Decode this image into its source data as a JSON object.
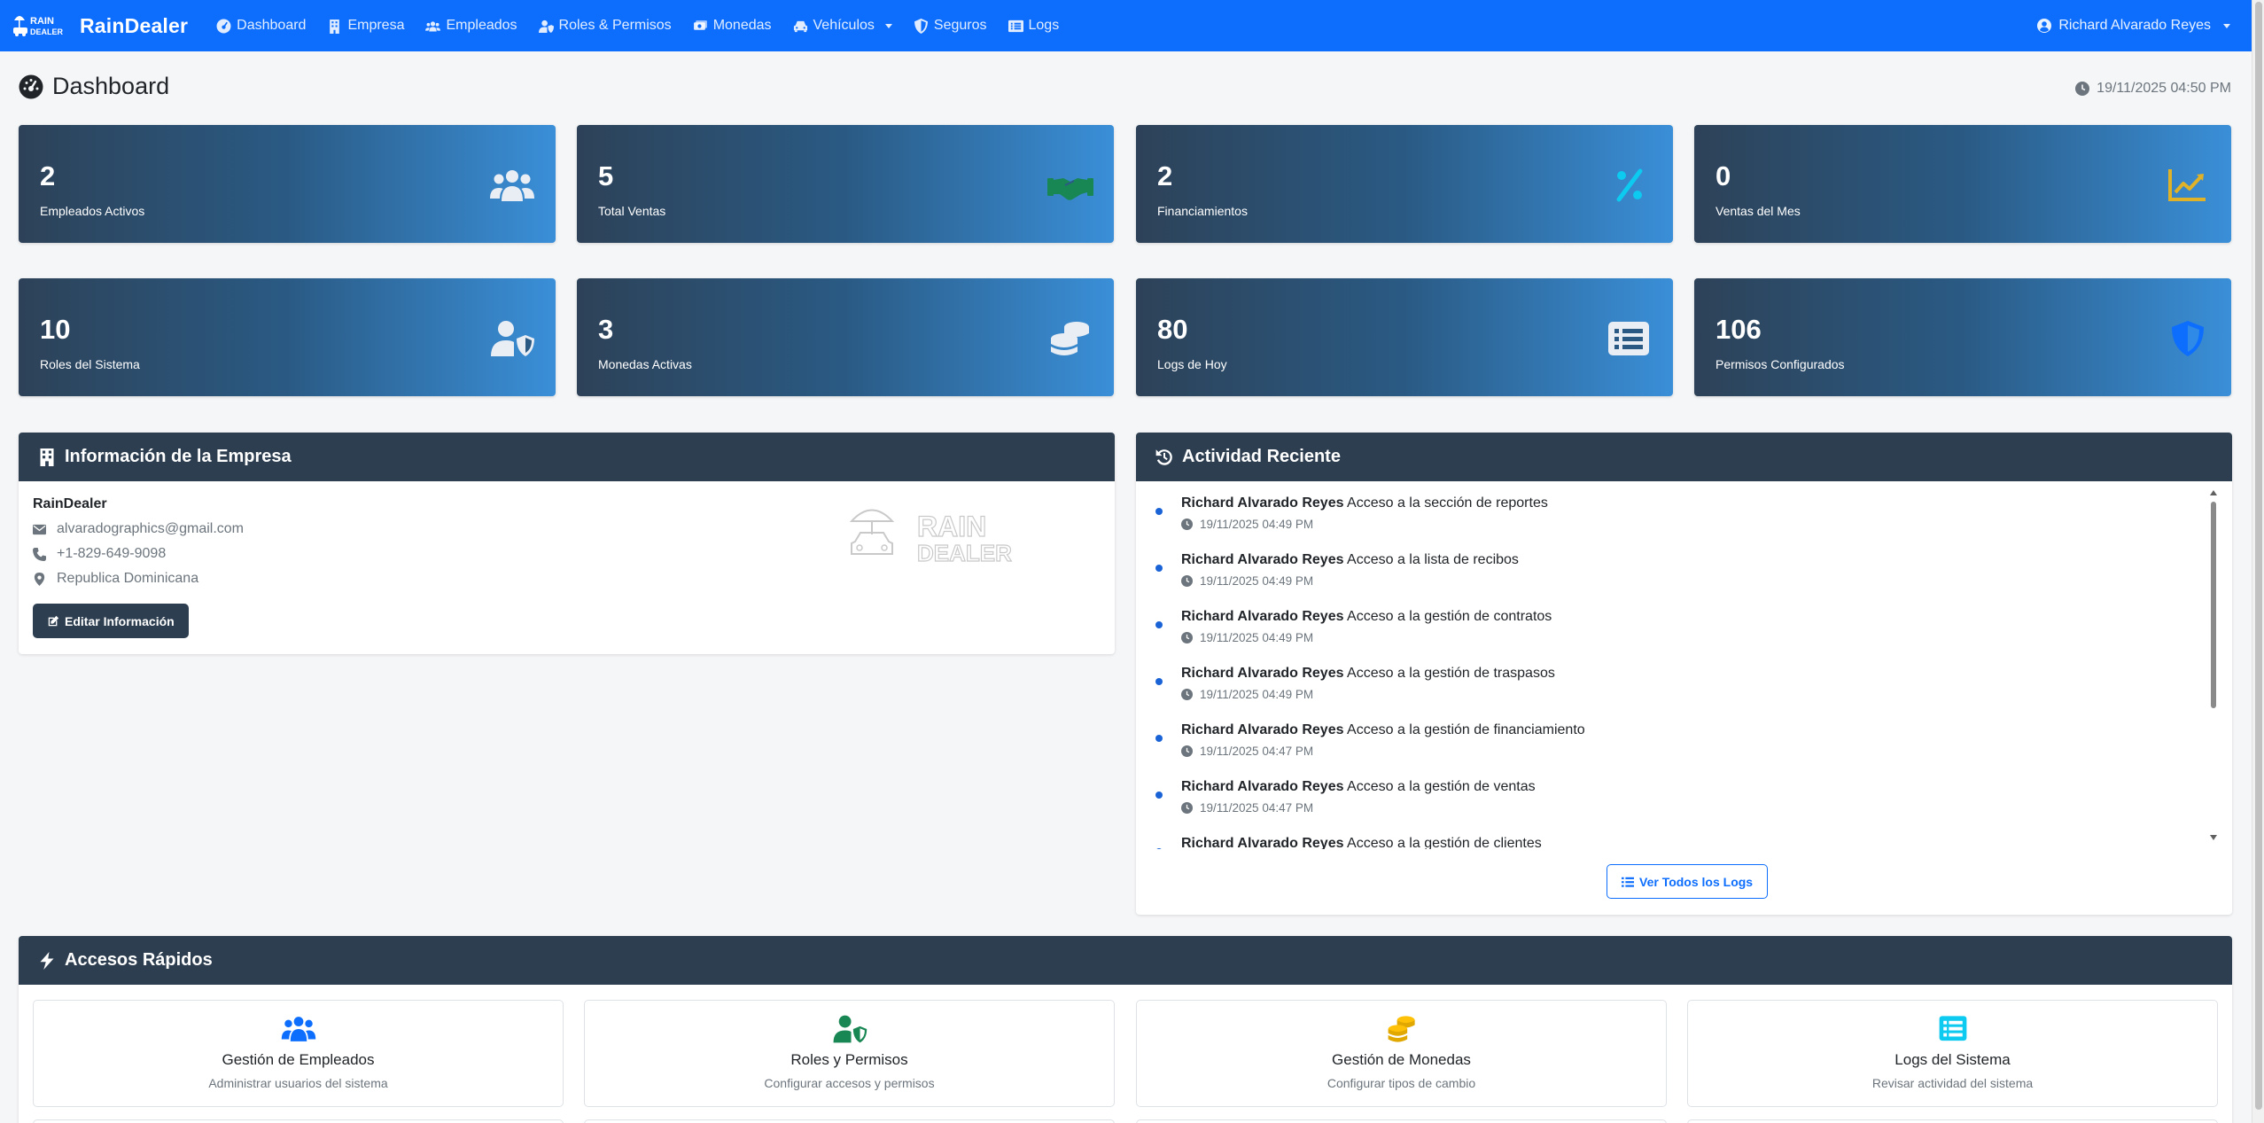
{
  "navbar": {
    "brand_logo_text": "RAIN DEALER",
    "brand": "RainDealer",
    "items": [
      {
        "label": "Dashboard",
        "icon": "dashboard-icon"
      },
      {
        "label": "Empresa",
        "icon": "building-icon"
      },
      {
        "label": "Empleados",
        "icon": "users-icon"
      },
      {
        "label": "Roles & Permisos",
        "icon": "user-shield-icon"
      },
      {
        "label": "Monedas",
        "icon": "money-icon"
      },
      {
        "label": "Vehículos",
        "icon": "car-icon",
        "dropdown": true
      },
      {
        "label": "Seguros",
        "icon": "shield-icon"
      },
      {
        "label": "Logs",
        "icon": "list-icon"
      }
    ],
    "user": "Richard Alvarado Reyes"
  },
  "header": {
    "title": "Dashboard",
    "timestamp": "19/11/2025 04:50 PM"
  },
  "stats": [
    {
      "value": "2",
      "label": "Empleados Activos",
      "icon": "users-icon",
      "color": "#e9eef5"
    },
    {
      "value": "5",
      "label": "Total Ventas",
      "icon": "handshake-icon",
      "color": "#198754"
    },
    {
      "value": "2",
      "label": "Financiamientos",
      "icon": "percent-icon",
      "color": "#0dcaf0"
    },
    {
      "value": "0",
      "label": "Ventas del Mes",
      "icon": "chart-line-icon",
      "color": "#e0b228"
    },
    {
      "value": "10",
      "label": "Roles del Sistema",
      "icon": "user-shield-icon",
      "color": "#e9eef5"
    },
    {
      "value": "3",
      "label": "Monedas Activas",
      "icon": "coins-icon",
      "color": "#e9eef5"
    },
    {
      "value": "80",
      "label": "Logs de Hoy",
      "icon": "list-alt-icon",
      "color": "#e9eef5"
    },
    {
      "value": "106",
      "label": "Permisos Configurados",
      "icon": "shield-icon",
      "color": "#0d6efd"
    }
  ],
  "company": {
    "title": "Información de la Empresa",
    "name": "RainDealer",
    "email": "alvaradographics@gmail.com",
    "phone": "+1-829-649-9098",
    "location": "Republica Dominicana",
    "edit_button": "Editar Información",
    "watermark_text": "RAIN DEALER"
  },
  "activity": {
    "title": "Actividad Reciente",
    "items": [
      {
        "user": "Richard Alvarado Reyes",
        "action": "Acceso a la sección de reportes",
        "time": "19/11/2025 04:49 PM"
      },
      {
        "user": "Richard Alvarado Reyes",
        "action": "Acceso a la lista de recibos",
        "time": "19/11/2025 04:49 PM"
      },
      {
        "user": "Richard Alvarado Reyes",
        "action": "Acceso a la gestión de contratos",
        "time": "19/11/2025 04:49 PM"
      },
      {
        "user": "Richard Alvarado Reyes",
        "action": "Acceso a la gestión de traspasos",
        "time": "19/11/2025 04:49 PM"
      },
      {
        "user": "Richard Alvarado Reyes",
        "action": "Acceso a la gestión de financiamiento",
        "time": "19/11/2025 04:47 PM"
      },
      {
        "user": "Richard Alvarado Reyes",
        "action": "Acceso a la gestión de ventas",
        "time": "19/11/2025 04:47 PM"
      },
      {
        "user": "Richard Alvarado Reyes",
        "action": "Acceso a la gestión de clientes",
        "time": ""
      }
    ],
    "view_all_button": "Ver Todos los Logs"
  },
  "quick_access": {
    "title": "Accesos Rápidos",
    "items": [
      {
        "title": "Gestión de Empleados",
        "desc": "Administrar usuarios del sistema",
        "icon": "users-icon",
        "color": "#0d6efd"
      },
      {
        "title": "Roles y Permisos",
        "desc": "Configurar accesos y permisos",
        "icon": "user-shield-icon",
        "color": "#198754"
      },
      {
        "title": "Gestión de Monedas",
        "desc": "Configurar tipos de cambio",
        "icon": "coins-icon",
        "color": "#ffc107"
      },
      {
        "title": "Logs del Sistema",
        "desc": "Revisar actividad del sistema",
        "icon": "list-alt-icon",
        "color": "#0dcaf0"
      }
    ]
  }
}
